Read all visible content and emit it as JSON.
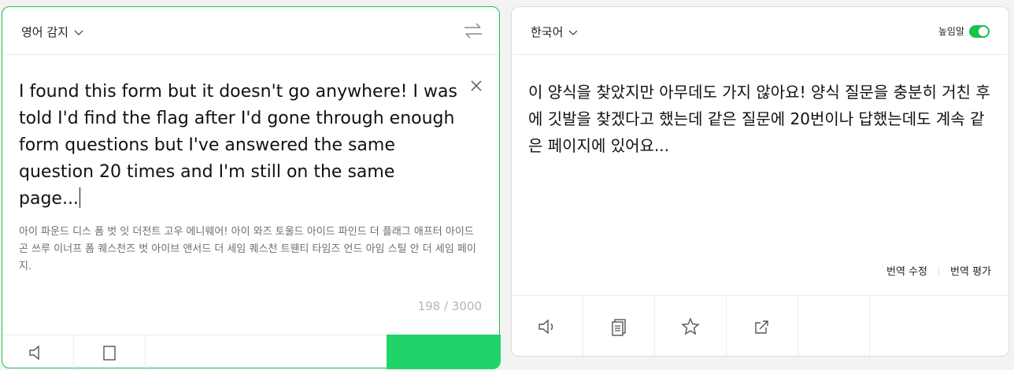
{
  "source": {
    "language": "영어 감지",
    "text": "I found this form but it doesn't go anywhere! I was told I'd find the flag after I'd gone through enough form questions but I've answered the same question 20 times and I'm still on the same page...",
    "pronunciation": "아이 파운드 디스 폼 벗 잇 더전트 고우 에니웨어! 아이 와즈 토울드 아이드 파인드 더 플래그 애프터 아이드 곤 쓰루 이너프 폼 퀘스천즈 벗 아이브 앤서드 더 세임 퀘스천 트웬티 타임즈 언드 아임 스틸 안 더 세임 페이지.",
    "char_count": "198 / 3000"
  },
  "target": {
    "language": "한국어",
    "honorific_label": "높임말",
    "text": "이 양식을 찾았지만 아무데도 가지 않아요! 양식 질문을 충분히 거친 후에 깃발을 찾겠다고 했는데 같은 질문에 20번이나 답했는데도 계속 같은 페이지에 있어요...",
    "edit_label": "번역 수정",
    "rate_label": "번역 평가"
  },
  "icons": {
    "swap": "swap-arrows-icon",
    "clear": "close-icon",
    "speaker": "speaker-icon",
    "copy": "copy-icon",
    "star": "star-icon",
    "share": "share-icon",
    "chevron": "chevron-down-icon"
  },
  "colors": {
    "accent": "#19c44d",
    "translate_button": "#21d46a"
  }
}
